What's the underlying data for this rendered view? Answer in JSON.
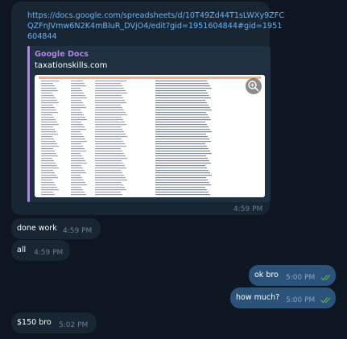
{
  "messages": {
    "link_message": {
      "url": "https://docs.google.com/spreadsheets/d/10T49Zd44T1sLWXy9ZFCQZFnJVmw6N2K4mBluR_DVjO4/edit?gid=1951604844#gid=1951604844",
      "preview_site": "Google Docs",
      "preview_title": "taxationskills.com",
      "time": "4:59 PM"
    },
    "done_work": {
      "text": "done work",
      "time": "4:59 PM"
    },
    "all": {
      "text": "all",
      "time": "4:59 PM"
    },
    "ok_bro": {
      "text": "ok bro",
      "time": "5:00 PM"
    },
    "how_much": {
      "text": "how much?",
      "time": "5:00 PM"
    },
    "price": {
      "text": "$150 bro",
      "time": "5:02 PM"
    }
  },
  "colors": {
    "background": "#0e1621",
    "incoming_bubble": "#182533",
    "outgoing_bubble": "#2b5278",
    "link": "#6ab3f3",
    "site_name": "#b085e6",
    "read_ticks": "#4fae4e"
  },
  "icons": {
    "zoom": "zoom-in-icon",
    "read_status": "double-check-icon"
  }
}
